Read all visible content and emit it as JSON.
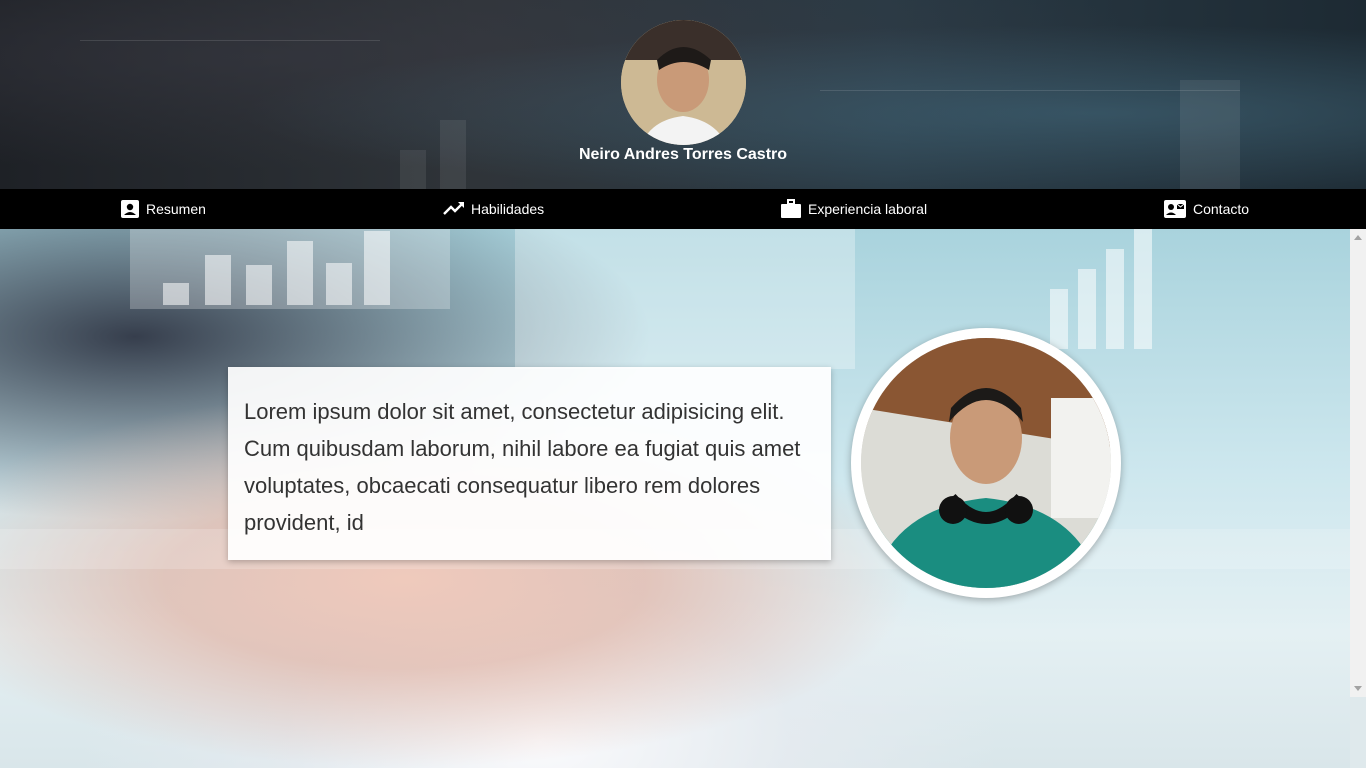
{
  "profile": {
    "name": "Neiro Andres Torres Castro",
    "avatar_icon": "profile-photo"
  },
  "nav": {
    "items": [
      {
        "label": "Resumen",
        "icon": "contact-card-icon"
      },
      {
        "label": "Habilidades",
        "icon": "trending-up-icon"
      },
      {
        "label": "Experiencia laboral",
        "icon": "briefcase-icon"
      },
      {
        "label": "Contacto",
        "icon": "contact-mail-icon"
      }
    ]
  },
  "summary": {
    "text": "Lorem ipsum dolor sit amet, consectetur adipisicing elit. Cum quibusdam laborum, nihil labore ea fugiat quis amet voluptates, obcaecati consequatur libero rem dolores provident, id"
  },
  "colors": {
    "nav_background": "#000000",
    "text_light": "#ffffff",
    "summary_text": "#333333"
  }
}
